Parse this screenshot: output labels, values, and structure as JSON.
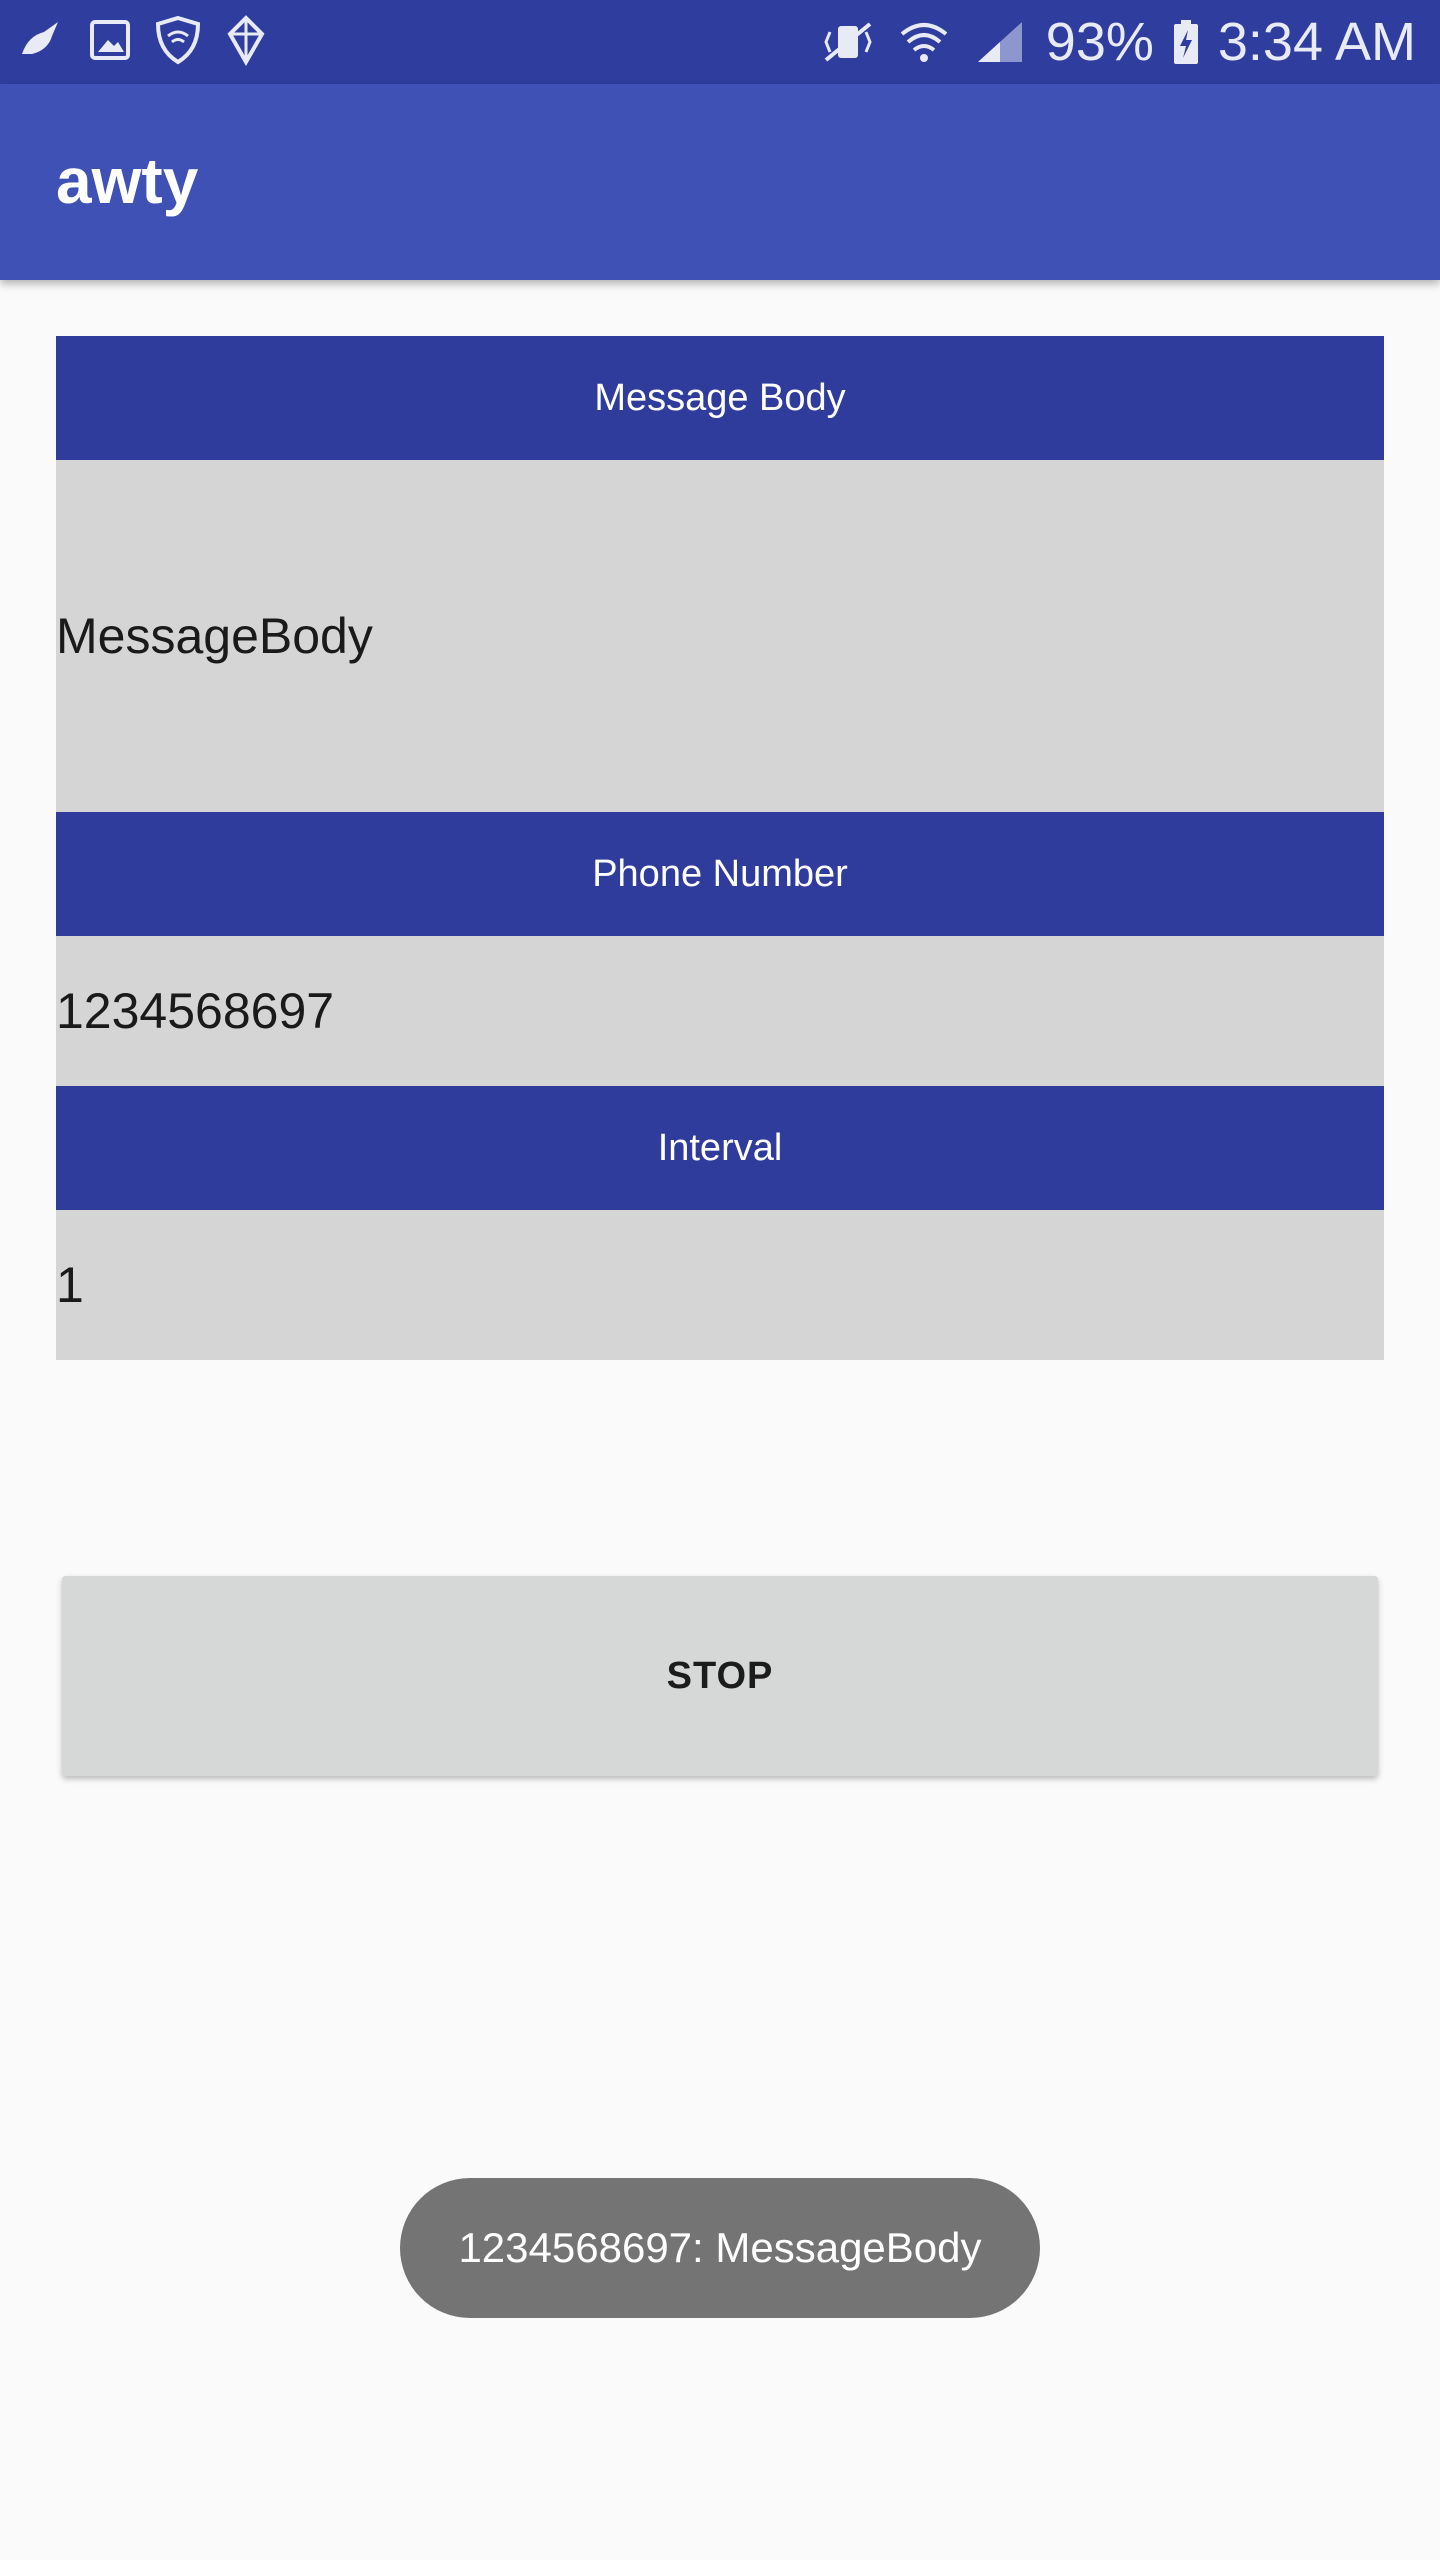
{
  "status_bar": {
    "battery": "93%",
    "time": "3:34 AM",
    "left_icons": [
      "bird-icon",
      "gallery-icon",
      "shield-wifi-icon",
      "gem-icon"
    ],
    "right_icons": [
      "vibrate-icon",
      "wifi-icon",
      "signal-icon",
      "battery-charging-icon"
    ]
  },
  "app_bar": {
    "title": "awty"
  },
  "form": {
    "message_header": "Message Body",
    "message_value": "MessageBody",
    "phone_header": "Phone Number",
    "phone_value": "1234568697",
    "interval_header": "Interval",
    "interval_value": "1"
  },
  "actions": {
    "stop_label": "STOP"
  },
  "toast": {
    "text": "1234568697: MessageBody"
  },
  "colors": {
    "status_bar": "#2f3e9e",
    "app_bar": "#3f51b5",
    "section_header": "#2f3c9c",
    "field_bg": "#d5d5d5",
    "toast_bg": "#747474"
  }
}
